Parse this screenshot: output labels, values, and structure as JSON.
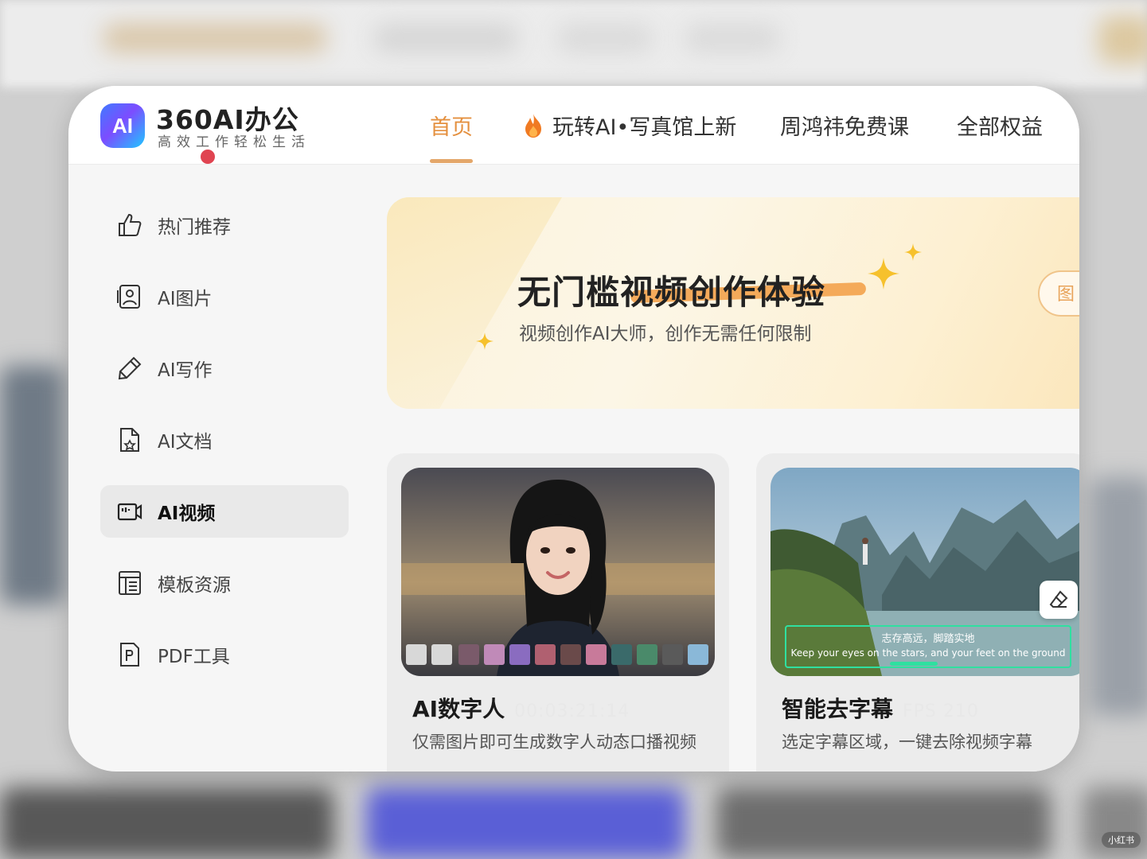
{
  "header": {
    "logo_badge": "AI",
    "logo_name": "360AI办公",
    "logo_slogan": "高效工作轻松生活",
    "nav": [
      {
        "label": "首页",
        "active": true
      },
      {
        "label": "玩转AI•写真馆上新",
        "icon": "fire-icon"
      },
      {
        "label": "周鸿祎免费课"
      },
      {
        "label": "全部权益"
      }
    ],
    "accent_color": "#e4903f"
  },
  "sidebar": {
    "items": [
      {
        "label": "热门推荐",
        "icon": "thumbs-up-icon"
      },
      {
        "label": "AI图片",
        "icon": "image-icon"
      },
      {
        "label": "AI写作",
        "icon": "pen-icon"
      },
      {
        "label": "AI文档",
        "icon": "document-icon"
      },
      {
        "label": "AI视频",
        "icon": "video-icon",
        "active": true
      },
      {
        "label": "模板资源",
        "icon": "template-icon"
      },
      {
        "label": "PDF工具",
        "icon": "pdf-icon"
      }
    ]
  },
  "banner": {
    "title": "无门槛视频创作体验",
    "subtitle": "视频创作AI大师，创作无需任何限制",
    "button_label": "图"
  },
  "cards": [
    {
      "title": "AI数字人",
      "ghost": "00:03:21:14",
      "description": "仅需图片即可生成数字人动态口播视频"
    },
    {
      "title": "智能去字幕",
      "ghost": "FPS 210",
      "description": "选定字幕区域，一键去除视频字幕",
      "subtitle_cn": "志存高远，脚踏实地",
      "subtitle_en": "Keep your eyes on the stars, and your feet on the ground"
    }
  ],
  "watermark": "小红书"
}
